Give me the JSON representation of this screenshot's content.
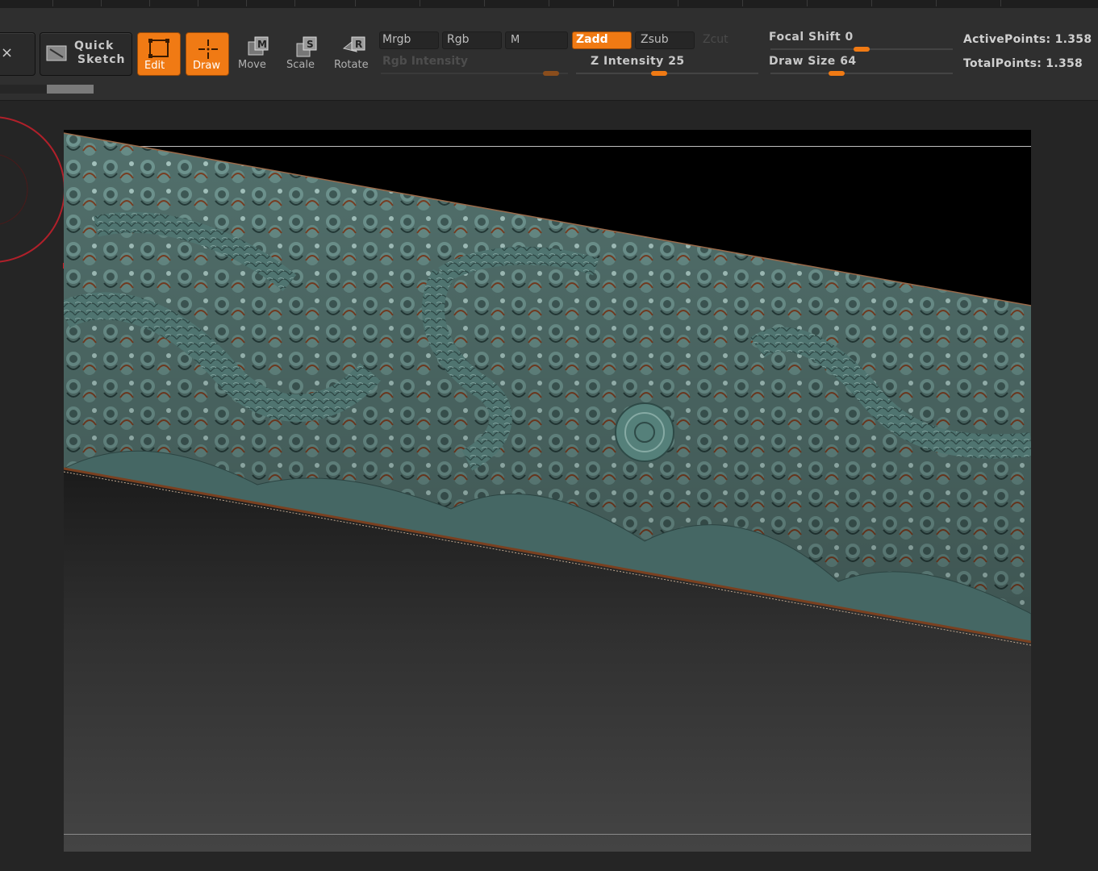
{
  "toolbar": {
    "close_glyph": "×",
    "quick_sketch": {
      "line1": "Quick",
      "line2": "Sketch"
    },
    "edit_label": "Edit",
    "draw_label": "Draw",
    "move": {
      "label": "Move",
      "key": "M"
    },
    "scale": {
      "label": "Scale",
      "key": "S"
    },
    "rotate": {
      "label": "Rotate",
      "key": "R"
    },
    "mrgb_label": "Mrgb",
    "rgb_label": "Rgb",
    "m_label": "M",
    "zadd_label": "Zadd",
    "zsub_label": "Zsub",
    "zcut_label": "Zcut",
    "rgb_intensity_label": "Rgb  Intensity",
    "z_intensity": {
      "label": "Z  Intensity",
      "value": "25"
    },
    "focal_shift": {
      "label": "Focal  Shift",
      "value": "0"
    },
    "draw_size": {
      "label": "Draw  Size",
      "value": "64"
    },
    "active_points": "ActivePoints: 1.358",
    "total_points": "TotalPoints: 1.358"
  },
  "slider_levels": {
    "rgb_intensity": 0.95,
    "z_intensity": 0.45,
    "focal_shift": 0.5,
    "draw_size": 0.35
  },
  "colors": {
    "accent": "#f07a14",
    "surface": "#4f7470",
    "surface_edge": "#8a4a2a",
    "panel": "#2f2f2f",
    "canvas_top": "#000000"
  },
  "icons": [
    "close-icon",
    "quick-sketch-icon",
    "edit-icon",
    "draw-icon",
    "move-icon",
    "scale-icon",
    "rotate-icon",
    "brush-gizmo-icon"
  ]
}
